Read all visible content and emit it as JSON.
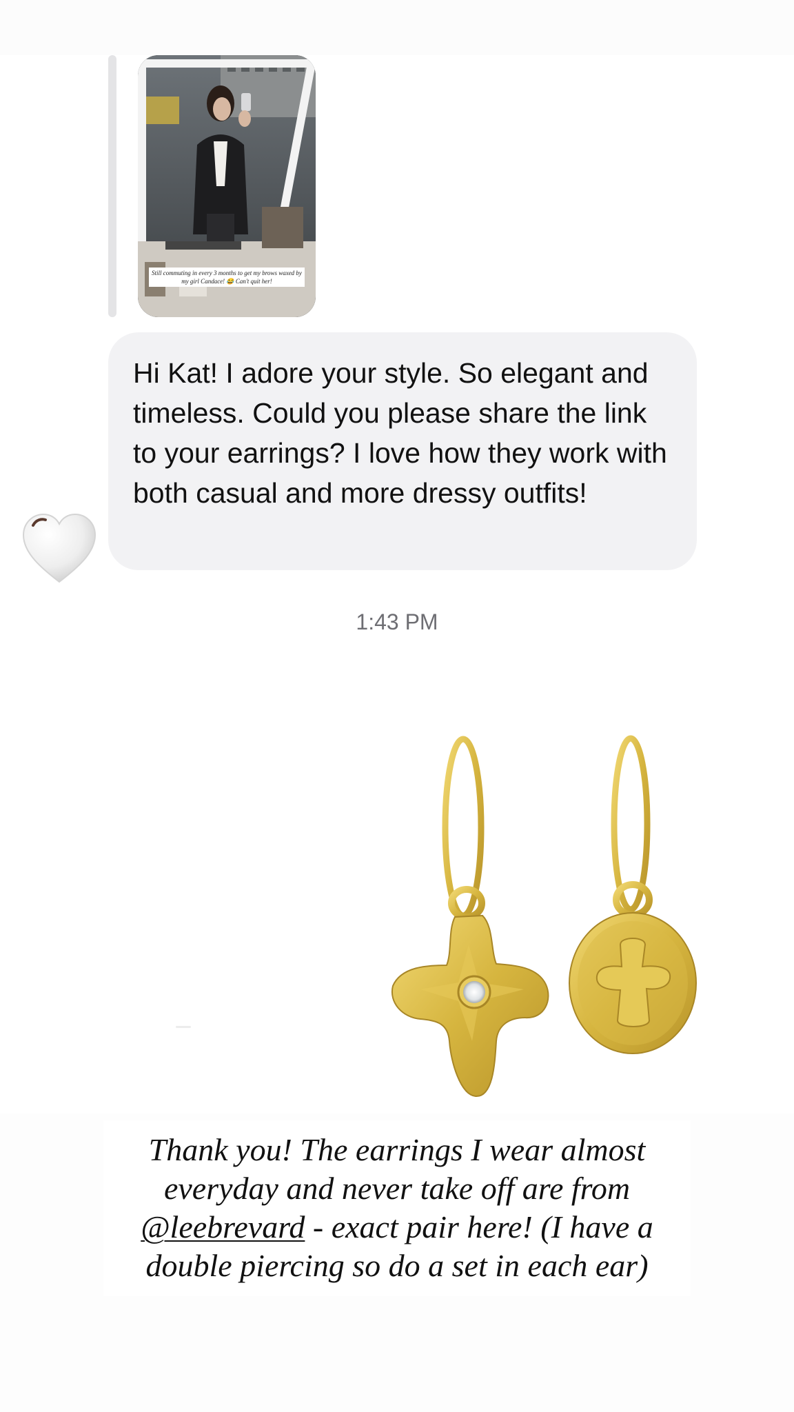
{
  "story": {
    "caption": "Still commuting in every 3 months to get my brows waxed by my girl Candace! 😂 Can't quit her!"
  },
  "message": {
    "text": "Hi Kat! I adore your style. So elegant and timeless. Could you please share the link to your earrings? I love how they work with both casual and more dressy outfits!",
    "reaction_icon": "white-heart-icon"
  },
  "timestamp": "1:43 PM",
  "reply": {
    "before_mention": "Thank you! The earrings I wear almost everyday and never take off are from ",
    "mention": "@leebrevard",
    "after_mention": " - exact pair here! (I have a double piercing so do a set in each ear)"
  },
  "colors": {
    "bubble": "#f2f2f4",
    "text": "#111111",
    "timestamp": "#6e6e73",
    "gold": "#d6b53f"
  }
}
